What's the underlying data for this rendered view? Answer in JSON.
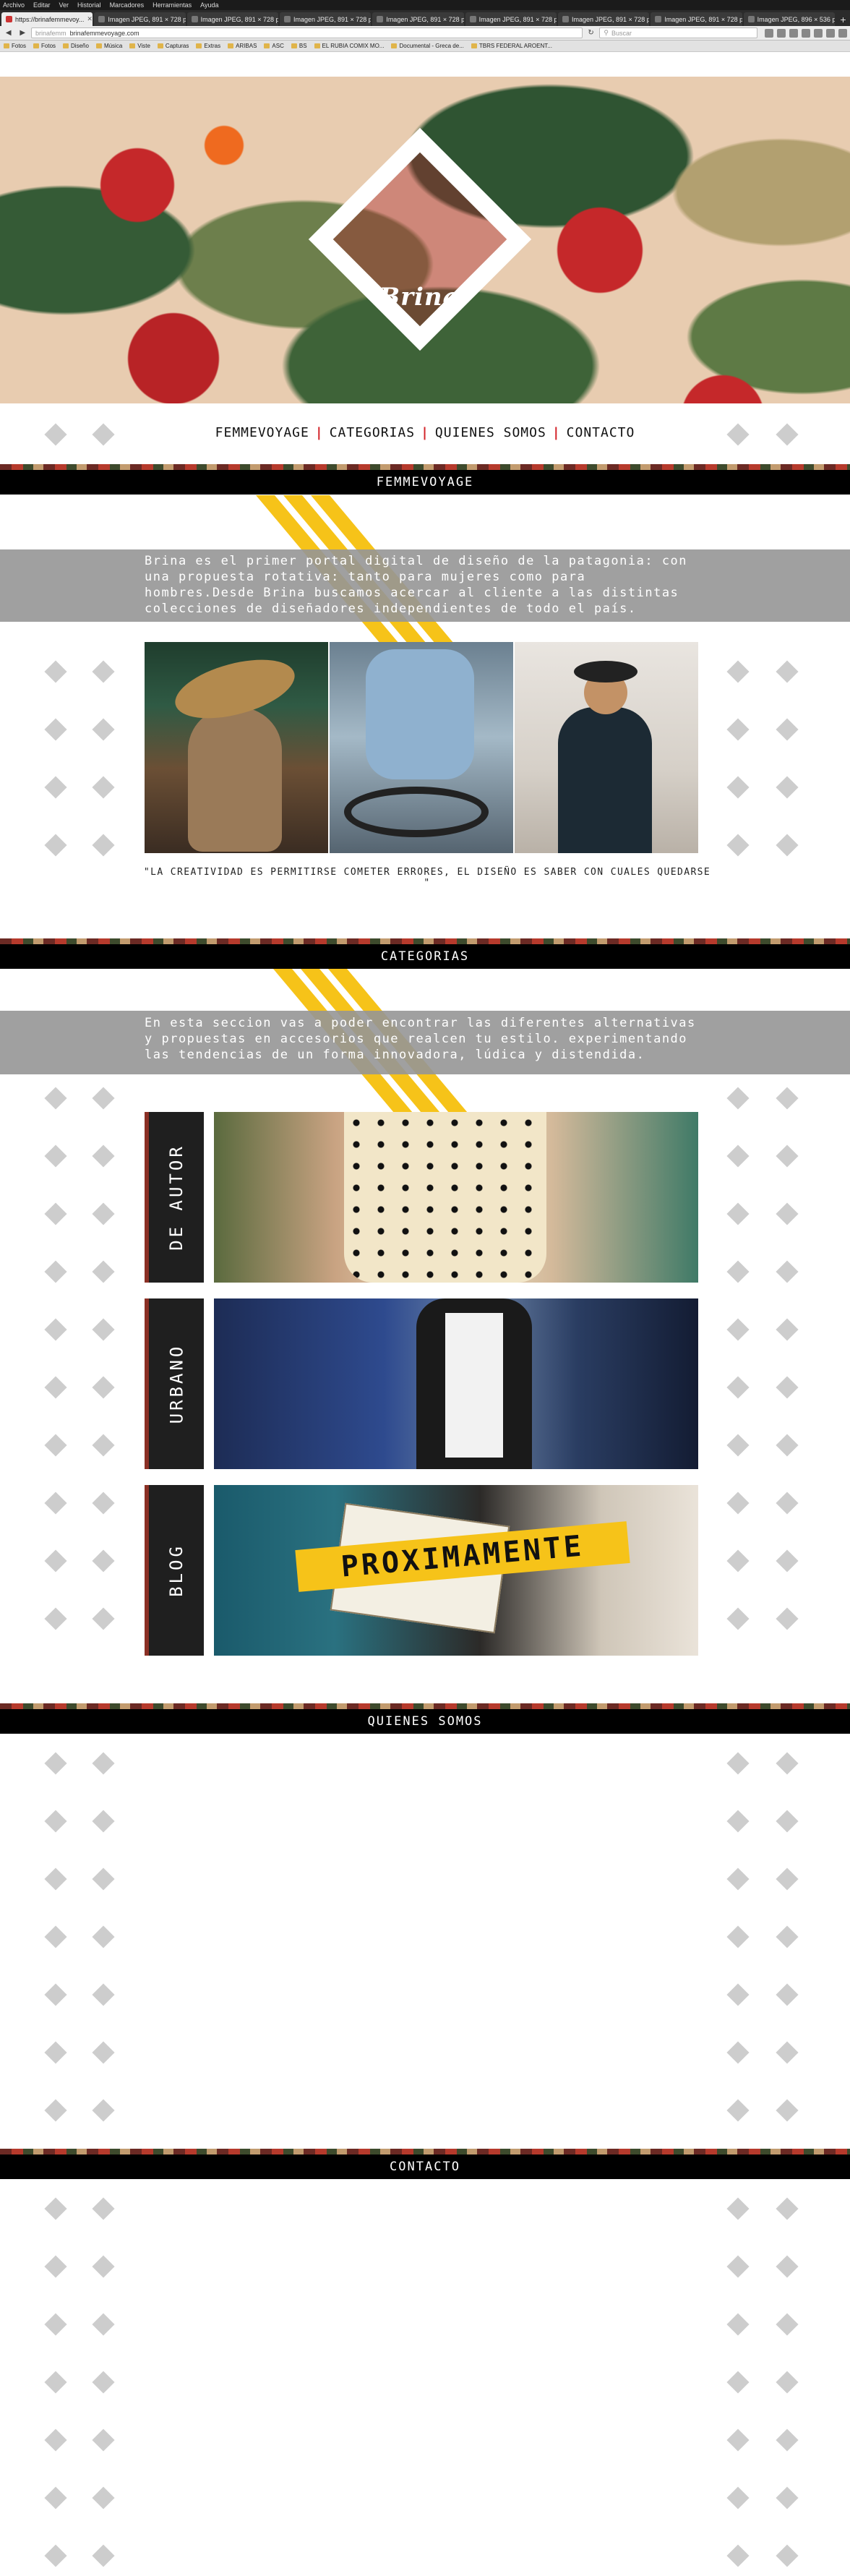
{
  "browser": {
    "menu": [
      "Archivo",
      "Editar",
      "Ver",
      "Historial",
      "Marcadores",
      "Herramientas",
      "Ayuda"
    ],
    "tabs": [
      {
        "label": "https://brinafemmevoy...",
        "active": true
      },
      {
        "label": "Imagen JPEG, 891 × 728 píx...",
        "active": false
      },
      {
        "label": "Imagen JPEG, 891 × 728 píx...",
        "active": false
      },
      {
        "label": "Imagen JPEG, 891 × 728 píx...",
        "active": false
      },
      {
        "label": "Imagen JPEG, 891 × 728 píx...",
        "active": false
      },
      {
        "label": "Imagen JPEG, 891 × 728 píx...",
        "active": false
      },
      {
        "label": "Imagen JPEG, 891 × 728 píx...",
        "active": false
      },
      {
        "label": "Imagen JPEG, 891 × 728 píx...",
        "active": false
      },
      {
        "label": "Imagen JPEG, 896 × 536 píx...",
        "active": false
      }
    ],
    "url_prefix": "brinafemm",
    "url": "brinafemmevoyage.com",
    "search_placeholder": "Buscar",
    "bookmarks": [
      "",
      "",
      "",
      "",
      "",
      "Fotos",
      "Fotos",
      "Diseño",
      "Música",
      "Viste",
      "Capturas",
      "Extras",
      "ARIBAS",
      "ASC",
      "",
      "BS",
      "",
      "",
      "EL RUBIA COMIX MO...",
      "",
      "Documental - Greca de...",
      "",
      "TBRS FEDERAL AROENT..."
    ]
  },
  "hero": {
    "logo_text": "Brina"
  },
  "nav": {
    "items": [
      "FEMMEVOYAGE",
      "CATEGORIAS",
      "QUIENES SOMOS",
      "CONTACTO"
    ]
  },
  "sections": {
    "femmevoyage": {
      "title": "FEMMEVOYAGE",
      "text": "Brina es el primer portal digital de diseño de la patagonia: con una propuesta rotativa: tanto para mujeres como para hombres.Desde Brina buscamos acercar al cliente a las distintas colecciones de diseñadores independientes de todo el país.",
      "quote": "\"LA CREATIVIDAD ES PERMITIRSE COMETER ERRORES, EL DISEÑO ES SABER CON CUALES QUEDARSE \""
    },
    "categorias": {
      "title": "CATEGORIAS",
      "text": "En esta seccion vas a poder encontrar las diferentes alternativas y propuestas en accesorios que realcen tu estilo. experimentando las tendencias de un forma innovadora, lúdica y distendida.",
      "items": [
        {
          "label": "DE AUTOR"
        },
        {
          "label": "URBANO"
        },
        {
          "label": "BLOG",
          "badge": "PROXIMAMENTE"
        }
      ]
    },
    "quienes_somos": {
      "title": "QUIENES SOMOS"
    },
    "contacto": {
      "title": "CONTACTO"
    }
  },
  "colors": {
    "accent_yellow": "#f6c319",
    "nav_separator_red": "#d3252b",
    "header_bar": "#000000",
    "text_band_grey": "#969696",
    "diamond_grey": "#cdcdcd"
  }
}
